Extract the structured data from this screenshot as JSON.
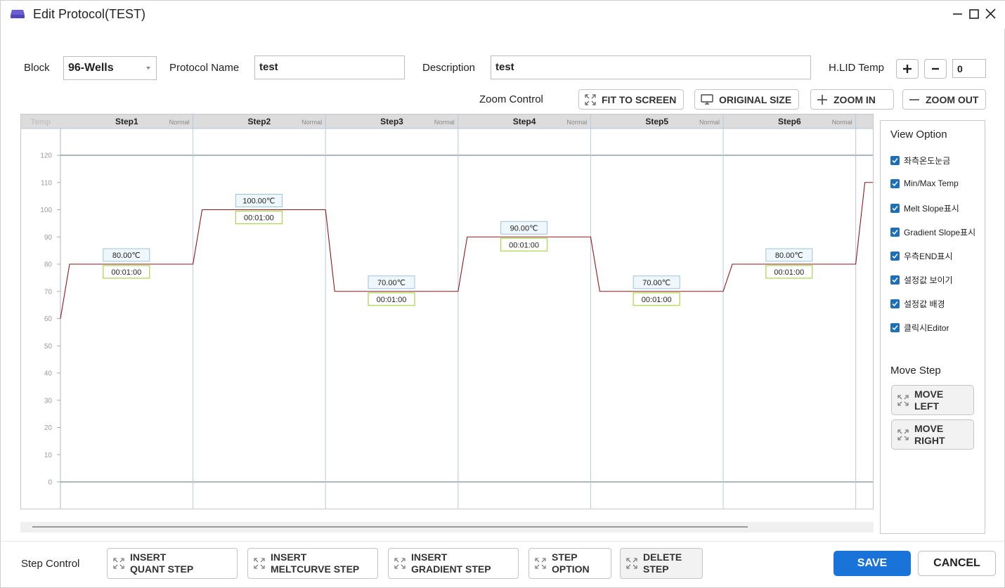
{
  "window": {
    "title": "Edit Protocol(TEST)"
  },
  "form": {
    "block_label": "Block",
    "block_value": "96-Wells",
    "protocol_name_label": "Protocol Name",
    "protocol_name_value": "test",
    "description_label": "Description",
    "description_value": "test",
    "hlid_label": "H.LID Temp",
    "hlid_value": "0"
  },
  "zoom": {
    "label": "Zoom Control",
    "fit": "FIT TO SCREEN",
    "original": "ORIGINAL SIZE",
    "zoom_in": "ZOOM IN",
    "zoom_out": "ZOOM OUT"
  },
  "chart_data": {
    "type": "line",
    "y_axis_title": "Temp",
    "ylim": [
      0,
      120
    ],
    "yticks": [
      0,
      10,
      20,
      30,
      40,
      50,
      60,
      70,
      80,
      90,
      100,
      110,
      120
    ],
    "start_temp": 60,
    "steps": [
      {
        "name": "Step1",
        "mode": "Normal",
        "temp": 80,
        "temp_label": "80.00℃",
        "time": "00:01:00"
      },
      {
        "name": "Step2",
        "mode": "Normal",
        "temp": 100,
        "temp_label": "100.00℃",
        "time": "00:01:00"
      },
      {
        "name": "Step3",
        "mode": "Normal",
        "temp": 70,
        "temp_label": "70.00℃",
        "time": "00:01:00"
      },
      {
        "name": "Step4",
        "mode": "Normal",
        "temp": 90,
        "temp_label": "90.00℃",
        "time": "00:01:00"
      },
      {
        "name": "Step5",
        "mode": "Normal",
        "temp": 70,
        "temp_label": "70.00℃",
        "time": "00:01:00"
      },
      {
        "name": "Step6",
        "mode": "Normal",
        "temp": 80,
        "temp_label": "80.00℃",
        "time": "00:01:00"
      }
    ],
    "next_step_temp": 110,
    "line_color": "#8b1a1a"
  },
  "view_option": {
    "title": "View Option",
    "items": [
      {
        "label": "좌측온도눈금",
        "checked": true
      },
      {
        "label": "Min/Max Temp",
        "checked": true
      },
      {
        "label": "Melt Slope표시",
        "checked": true
      },
      {
        "label": "Gradient Slope표시",
        "checked": true
      },
      {
        "label": "우측END표시",
        "checked": true
      },
      {
        "label": "설정값 보이기",
        "checked": true
      },
      {
        "label": "설정값 배경",
        "checked": true
      },
      {
        "label": "클릭시Editor",
        "checked": true
      }
    ]
  },
  "move_step": {
    "title": "Move Step",
    "left_line1": "MOVE",
    "left_line2": "LEFT",
    "right_line1": "MOVE",
    "right_line2": "RIGHT"
  },
  "step_control": {
    "label": "Step Control",
    "insert_quant_1": "INSERT",
    "insert_quant_2": "QUANT STEP",
    "insert_melt_1": "INSERT",
    "insert_melt_2": "MELTCURVE STEP",
    "insert_gradient_1": "INSERT",
    "insert_gradient_2": "GRADIENT STEP",
    "step_option_1": "STEP",
    "step_option_2": "OPTION",
    "delete_step_1": "DELETE",
    "delete_step_2": "STEP"
  },
  "actions": {
    "save": "SAVE",
    "cancel": "CANCEL"
  },
  "colors": {
    "accent": "#1a73d9",
    "checkbox": "#1f6fb7",
    "temp_box_bg": "#eef7fb",
    "time_box_border": "#a8d64a"
  }
}
